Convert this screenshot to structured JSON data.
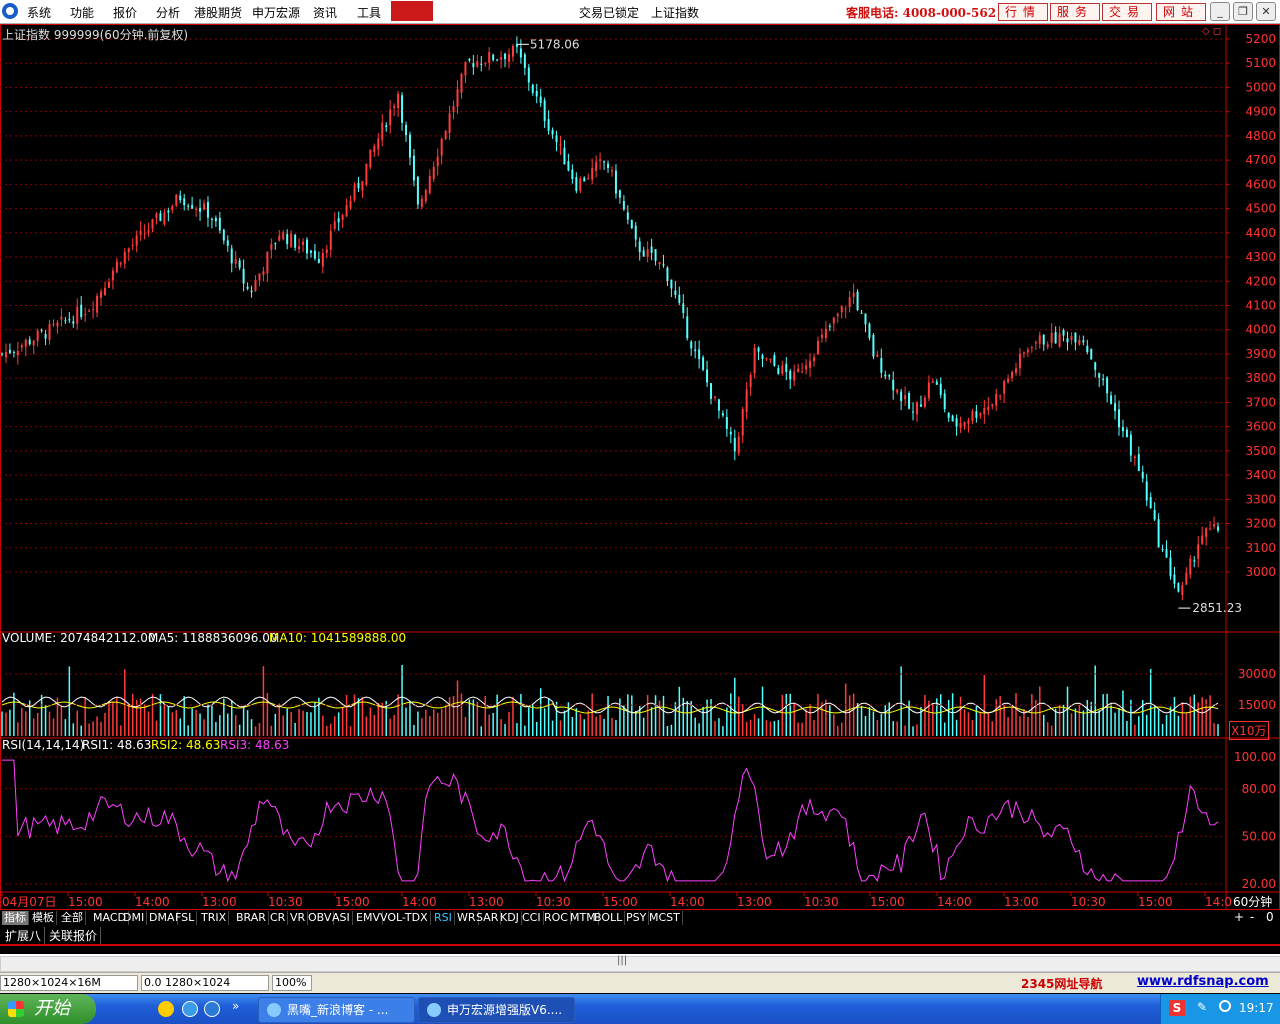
{
  "menubar": {
    "items": [
      "系统",
      "功能",
      "报价",
      "分析",
      "港股期货",
      "申万宏源",
      "资讯",
      "工具"
    ],
    "status_lock": "交易已锁定",
    "index_name": "上证指数",
    "hotline": "客服电话: 4008-000-562",
    "top_buttons": [
      "行情",
      "服务",
      "交易",
      "网站"
    ]
  },
  "main_chart": {
    "title": "上证指数 999999(60分钟.前复权)",
    "high_label": "5178.06",
    "low_label": "2851.23",
    "y_ticks": [
      "5200",
      "5100",
      "5000",
      "4900",
      "4800",
      "4700",
      "4600",
      "4500",
      "4400",
      "4300",
      "4200",
      "4100",
      "4000",
      "3900",
      "3800",
      "3700",
      "3600",
      "3500",
      "3400",
      "3300",
      "3200",
      "3100",
      "3000"
    ]
  },
  "volume_panel": {
    "label": "VOLUME: 2074842112.00",
    "ma5": "MA5: 1188836096.00",
    "ma10": "MA10: 1041589888.00",
    "y_ticks": [
      "30000",
      "15000"
    ],
    "unit": "X10万"
  },
  "rsi_panel": {
    "label": "RSI(14,14,14)",
    "rsi1": "RSI1: 48.63",
    "rsi2": "RSI2: 48.63",
    "rsi3": "RSI3: 48.63",
    "y_ticks": [
      "100.00",
      "80.00",
      "50.00",
      "20.00"
    ]
  },
  "time_axis": {
    "labels": [
      "04月07日",
      "15:00",
      "14:00",
      "13:00",
      "10:30",
      "15:00",
      "14:00",
      "13:00",
      "10:30",
      "15:00",
      "14:00",
      "13:00",
      "10:30",
      "15:00",
      "14:00",
      "13:00",
      "10:30",
      "15:00",
      "14:0"
    ],
    "period": "60分钟"
  },
  "indicator_tabs": [
    "指标",
    "模板",
    "全部",
    "MACD",
    "DMI",
    "DMA",
    "FSL",
    "TRIX",
    "BRAR",
    "CR",
    "VR",
    "OBV",
    "ASI",
    "EMV",
    "VOL-TDX",
    "RSI",
    "WR",
    "SAR",
    "KDJ",
    "CCI",
    "ROC",
    "MTM",
    "BOLL",
    "PSY",
    "MCST"
  ],
  "indicator_active": "RSI",
  "sub_tabs": [
    "扩展八",
    "关联报价"
  ],
  "right_controls": [
    "+",
    "-",
    "0"
  ],
  "statusbar": {
    "resolution": "1280×1024×16M",
    "coords": "0.0 1280×1024",
    "zoom": "100%",
    "nav_text": "2345网址导航",
    "site": "www.rdfsnap.com"
  },
  "taskbar": {
    "start_label": "开始",
    "tasks": [
      "黑嘴_新浪博客 - ...",
      "申万宏源增强版V6...."
    ],
    "clock": "19:17"
  },
  "colors": {
    "up": "#ff3b3b",
    "down": "#54ffff",
    "grid": "#8b0000",
    "ma5": "#ffffff",
    "ma10": "#ffff00",
    "rsi": "#ff40ff"
  }
}
